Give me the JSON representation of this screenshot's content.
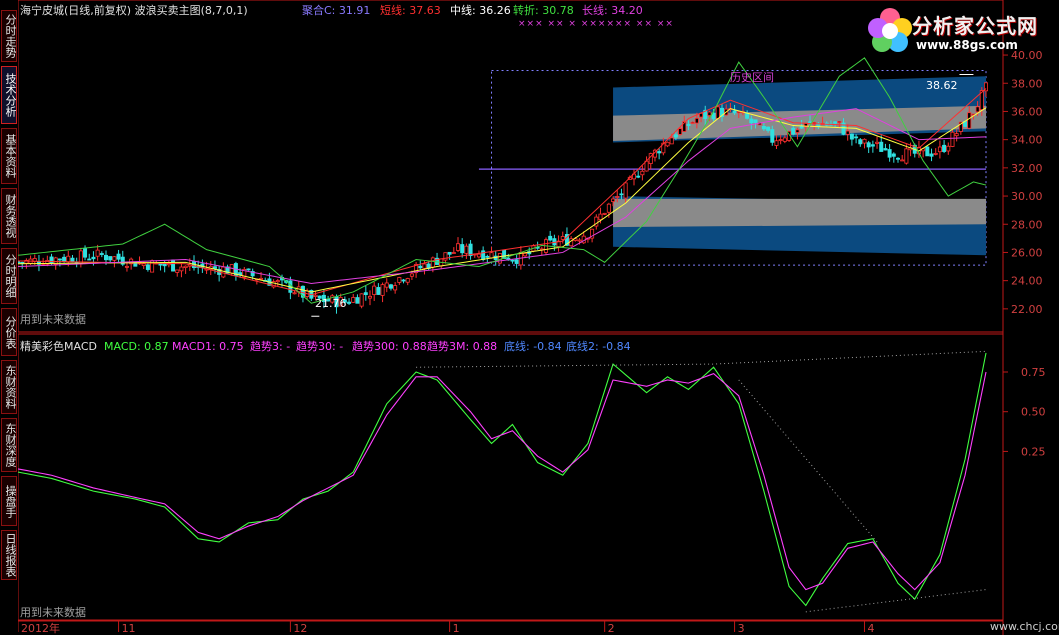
{
  "sidebar": {
    "tabs": [
      "分时走势",
      "技术分析",
      "基本资料",
      "财务透视",
      "分时明细",
      "分价表",
      "东财资料",
      "东财深度",
      "操盘手",
      "日线报表"
    ]
  },
  "header": {
    "title": "海宁皮城(日线,前复权) 波浪买卖主图(8,7,0,1)",
    "juhe_label": "聚合C: 31.91",
    "short_label": "短线: 37.63",
    "mid_label": "中线: 36.26",
    "turn_label": "转折: 30.78",
    "long_label": "长线: 34.20",
    "x_markers": "×××      ××  ×   ××××××      ××  ××",
    "zone_label": "历史区间",
    "high_label": "38.62",
    "low_label": "21.76",
    "future_note": "用到未来数据"
  },
  "sub": {
    "title": "精美彩色MACD",
    "macd_label": "MACD: 0.87",
    "macd1_label": "MACD1: 0.75",
    "trend3_label": "趋势3: -",
    "trend30_label": "趋势30: -",
    "trend300_label": "趋势300: 0.88",
    "trend3m_label": "趋势3M: 0.88",
    "bottom_label": "底线: -0.84",
    "bottom2_label": "底线2: -0.84",
    "future_note": "用到未来数据"
  },
  "logo": {
    "name": "分析家公式网",
    "url": "www.88gs.com"
  },
  "footer_site": "www.chcj.com",
  "colors": {
    "up": "#ff3030",
    "down": "#30e0e0",
    "short": "#ff3030",
    "mid": "#ffff40",
    "turn": "#40d040",
    "long": "#e040e0",
    "juhe": "#8080ff",
    "macd": "#40ff40",
    "macd1": "#ff40ff",
    "band_blue": "#0b4a80",
    "band_gray": "#8a8a8a",
    "axis": "#c01818"
  },
  "chart_data": [
    {
      "type": "candlestick",
      "title": "海宁皮城(日线,前复权) 波浪买卖主图(8,7,0,1)",
      "ylim": [
        20.5,
        40.5
      ],
      "yticks": [
        22,
        24,
        26,
        28,
        30,
        32,
        34,
        36,
        38,
        40
      ],
      "ytick_labels": [
        "22.00",
        "24.00",
        "26.00",
        "28.00",
        "30.00",
        "32.00",
        "34.00",
        "36.00",
        "38.00",
        "40.00"
      ],
      "x_labels": [
        "2012年",
        "11",
        "12",
        "1",
        "2",
        "3",
        "4"
      ],
      "x_label_index": [
        0,
        24,
        65,
        103,
        140,
        171,
        202
      ],
      "n": 232,
      "close_anchors": [
        [
          0,
          25.3
        ],
        [
          10,
          25.6
        ],
        [
          20,
          25.8
        ],
        [
          30,
          25.2
        ],
        [
          40,
          25.0
        ],
        [
          50,
          24.8
        ],
        [
          58,
          24.2
        ],
        [
          65,
          23.5
        ],
        [
          70,
          22.7
        ],
        [
          78,
          22.5
        ],
        [
          85,
          23.3
        ],
        [
          95,
          24.8
        ],
        [
          105,
          26.2
        ],
        [
          112,
          25.9
        ],
        [
          120,
          25.6
        ],
        [
          126,
          26.5
        ],
        [
          132,
          27.0
        ],
        [
          136,
          27.4
        ],
        [
          140,
          29.0
        ],
        [
          145,
          30.5
        ],
        [
          150,
          32.5
        ],
        [
          155,
          34.0
        ],
        [
          162,
          35.5
        ],
        [
          167,
          36.0
        ],
        [
          172,
          35.8
        ],
        [
          176,
          35.0
        ],
        [
          180,
          34.0
        ],
        [
          185,
          34.6
        ],
        [
          190,
          35.2
        ],
        [
          196,
          35.0
        ],
        [
          200,
          33.8
        ],
        [
          205,
          33.5
        ],
        [
          210,
          33.0
        ],
        [
          215,
          33.0
        ],
        [
          220,
          33.2
        ],
        [
          224,
          34.5
        ],
        [
          228,
          36.0
        ],
        [
          231,
          37.6
        ]
      ],
      "series": [
        {
          "name": "短线",
          "y": [
            [
              0,
              25.4
            ],
            [
              40,
              25.2
            ],
            [
              70,
              23.0
            ],
            [
              100,
              25.5
            ],
            [
              130,
              26.8
            ],
            [
              145,
              31.0
            ],
            [
              160,
              35.5
            ],
            [
              170,
              36.8
            ],
            [
              185,
              35.2
            ],
            [
              200,
              35.0
            ],
            [
              215,
              33.4
            ],
            [
              231,
              37.63
            ]
          ]
        },
        {
          "name": "中线",
          "y": [
            [
              0,
              25.2
            ],
            [
              40,
              25.3
            ],
            [
              70,
              23.2
            ],
            [
              100,
              25.0
            ],
            [
              130,
              26.4
            ],
            [
              145,
              29.5
            ],
            [
              160,
              33.8
            ],
            [
              170,
              36.2
            ],
            [
              185,
              35.0
            ],
            [
              200,
              34.8
            ],
            [
              215,
              33.2
            ],
            [
              231,
              36.26
            ]
          ]
        },
        {
          "name": "长线",
          "y": [
            [
              0,
              25.0
            ],
            [
              40,
              25.5
            ],
            [
              70,
              23.8
            ],
            [
              100,
              24.8
            ],
            [
              130,
              26.0
            ],
            [
              145,
              28.5
            ],
            [
              160,
              32.5
            ],
            [
              170,
              34.8
            ],
            [
              185,
              35.6
            ],
            [
              200,
              36.2
            ],
            [
              215,
              34.0
            ],
            [
              231,
              34.2
            ]
          ]
        },
        {
          "name": "转折",
          "y": [
            [
              0,
              25.8
            ],
            [
              25,
              26.6
            ],
            [
              35,
              28.0
            ],
            [
              45,
              26.2
            ],
            [
              60,
              25.0
            ],
            [
              70,
              22.4
            ],
            [
              80,
              23.2
            ],
            [
              95,
              25.5
            ],
            [
              110,
              25.0
            ],
            [
              125,
              26.5
            ],
            [
              135,
              26.2
            ],
            [
              140,
              25.3
            ],
            [
              150,
              28.2
            ],
            [
              158,
              32.0
            ],
            [
              166,
              36.0
            ],
            [
              172,
              39.5
            ],
            [
              178,
              37.0
            ],
            [
              186,
              33.5
            ],
            [
              196,
              38.5
            ],
            [
              202,
              39.8
            ],
            [
              208,
              37.0
            ],
            [
              216,
              32.5
            ],
            [
              222,
              30.0
            ],
            [
              228,
              31.0
            ],
            [
              231,
              30.78
            ]
          ]
        },
        {
          "name": "聚合C",
          "y": [
            [
              110,
              31.91
            ],
            [
              231,
              31.91
            ]
          ]
        }
      ],
      "zone_box": {
        "i0": 113,
        "i1": 231,
        "y0": 25.1,
        "y1": 38.9
      },
      "bands": [
        {
          "color": "blue",
          "i0": 142,
          "i1": 231,
          "top": [
            37.7,
            38.5
          ],
          "bottom": [
            33.8,
            34.6
          ]
        },
        {
          "color": "gray",
          "i0": 142,
          "i1": 231,
          "top": [
            35.7,
            36.4
          ],
          "bottom": [
            33.9,
            34.8
          ]
        },
        {
          "color": "blue",
          "i0": 142,
          "i1": 231,
          "top": [
            30.0,
            29.5
          ],
          "bottom": [
            26.4,
            25.8
          ]
        },
        {
          "color": "gray",
          "i0": 142,
          "i1": 231,
          "top": [
            29.8,
            29.8
          ],
          "bottom": [
            27.8,
            28.0
          ]
        }
      ],
      "high_mark": {
        "index": 228,
        "value": 38.62
      },
      "low_mark": {
        "index": 70,
        "value": 21.76
      }
    },
    {
      "type": "line",
      "title": "精美彩色MACD",
      "ylim": [
        -0.78,
        0.92
      ],
      "yticks": [
        0.75,
        0.5,
        0.25
      ],
      "ytick_labels": [
        "0.75",
        "0.50",
        "0.25"
      ],
      "n": 232,
      "series": [
        {
          "name": "MACD",
          "y": [
            [
              0,
              0.12
            ],
            [
              8,
              0.08
            ],
            [
              18,
              0.0
            ],
            [
              28,
              -0.05
            ],
            [
              35,
              -0.1
            ],
            [
              43,
              -0.3
            ],
            [
              48,
              -0.32
            ],
            [
              55,
              -0.2
            ],
            [
              62,
              -0.18
            ],
            [
              68,
              -0.05
            ],
            [
              74,
              0.0
            ],
            [
              80,
              0.12
            ],
            [
              88,
              0.55
            ],
            [
              95,
              0.75
            ],
            [
              100,
              0.7
            ],
            [
              108,
              0.45
            ],
            [
              113,
              0.3
            ],
            [
              118,
              0.42
            ],
            [
              124,
              0.18
            ],
            [
              130,
              0.1
            ],
            [
              136,
              0.3
            ],
            [
              142,
              0.8
            ],
            [
              150,
              0.62
            ],
            [
              155,
              0.72
            ],
            [
              160,
              0.64
            ],
            [
              166,
              0.78
            ],
            [
              172,
              0.55
            ],
            [
              178,
              0.0
            ],
            [
              184,
              -0.6
            ],
            [
              188,
              -0.72
            ],
            [
              192,
              -0.55
            ],
            [
              198,
              -0.33
            ],
            [
              204,
              -0.3
            ],
            [
              210,
              -0.58
            ],
            [
              214,
              -0.68
            ],
            [
              220,
              -0.4
            ],
            [
              226,
              0.2
            ],
            [
              231,
              0.87
            ]
          ]
        },
        {
          "name": "MACD1",
          "y": [
            [
              0,
              0.14
            ],
            [
              8,
              0.1
            ],
            [
              18,
              0.02
            ],
            [
              28,
              -0.04
            ],
            [
              35,
              -0.08
            ],
            [
              43,
              -0.26
            ],
            [
              48,
              -0.3
            ],
            [
              55,
              -0.22
            ],
            [
              62,
              -0.16
            ],
            [
              68,
              -0.06
            ],
            [
              74,
              0.02
            ],
            [
              80,
              0.1
            ],
            [
              88,
              0.48
            ],
            [
              95,
              0.72
            ],
            [
              100,
              0.72
            ],
            [
              108,
              0.5
            ],
            [
              113,
              0.33
            ],
            [
              118,
              0.38
            ],
            [
              124,
              0.22
            ],
            [
              130,
              0.12
            ],
            [
              136,
              0.26
            ],
            [
              142,
              0.7
            ],
            [
              150,
              0.66
            ],
            [
              155,
              0.7
            ],
            [
              160,
              0.68
            ],
            [
              166,
              0.74
            ],
            [
              172,
              0.6
            ],
            [
              178,
              0.1
            ],
            [
              184,
              -0.48
            ],
            [
              188,
              -0.62
            ],
            [
              192,
              -0.58
            ],
            [
              198,
              -0.36
            ],
            [
              204,
              -0.32
            ],
            [
              210,
              -0.52
            ],
            [
              214,
              -0.62
            ],
            [
              220,
              -0.45
            ],
            [
              226,
              0.1
            ],
            [
              231,
              0.75
            ]
          ]
        },
        {
          "name": "底线",
          "style": "dotted",
          "y": [
            [
              95,
              0.78
            ],
            [
              166,
              0.8
            ],
            [
              231,
              0.88
            ]
          ]
        },
        {
          "name": "底线2",
          "style": "dotted",
          "y": [
            [
              172,
              0.7
            ],
            [
              205,
              -0.32
            ]
          ]
        },
        {
          "name": "底线3",
          "style": "dotted",
          "y": [
            [
              188,
              -0.76
            ],
            [
              231,
              -0.62
            ]
          ]
        }
      ]
    }
  ]
}
